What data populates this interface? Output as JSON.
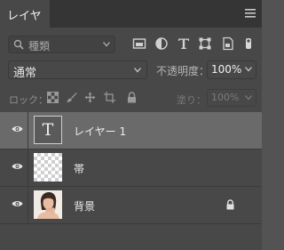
{
  "panel": {
    "tab_label": "レイヤー",
    "tab_close": "×",
    "menu_icon": "hamburger-menu-icon"
  },
  "filter": {
    "search_label": "種類",
    "icons": [
      "image-filter-icon",
      "adjustment-filter-icon",
      "type-filter-icon",
      "shape-filter-icon",
      "smartobject-filter-icon"
    ]
  },
  "blend": {
    "mode": "通常",
    "opacity_label": "不透明度：",
    "opacity_value": "100%"
  },
  "lock": {
    "label": "ロック：",
    "icons": [
      "lock-transparent-pixels-icon",
      "lock-image-pixels-icon",
      "lock-position-icon",
      "lock-artboard-icon",
      "lock-all-icon"
    ],
    "fill_label": "塗り：",
    "fill_value": "100%"
  },
  "layers": [
    {
      "name": "レイヤー 1",
      "thumb_letter": "T",
      "selected": true,
      "type": "text"
    },
    {
      "name": "帯",
      "selected": false,
      "type": "transparent"
    },
    {
      "name": "背景",
      "selected": false,
      "type": "photo",
      "locked": true
    }
  ]
}
